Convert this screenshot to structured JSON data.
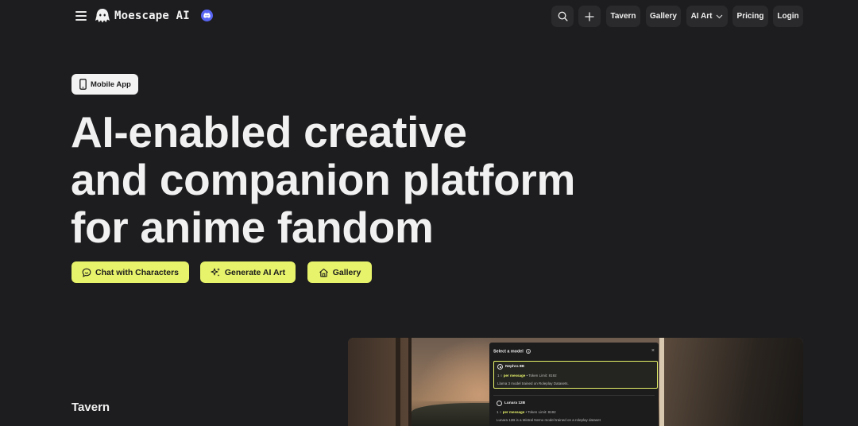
{
  "header": {
    "brand": "Moescape AI",
    "nav": {
      "tavern": "Tavern",
      "gallery": "Gallery",
      "ai_art": "AI Art",
      "pricing": "Pricing",
      "login": "Login"
    },
    "icons": [
      "menu-icon",
      "ghost-logo-icon",
      "discord-icon",
      "search-icon",
      "plus-icon",
      "chevron-down-icon"
    ]
  },
  "hero": {
    "mobile_app": "Mobile App",
    "headline": [
      "AI-enabled creative",
      "and companion platform",
      "for anime fandom"
    ],
    "cta": {
      "chat": "Chat with Characters",
      "generate": "Generate AI Art",
      "gallery": "Gallery"
    }
  },
  "section": {
    "tavern_label": "Tavern"
  },
  "preview_modal": {
    "title": "Select a model",
    "close": "×",
    "options": [
      {
        "name": "Nephra 8B",
        "cost_prefix": "1",
        "cost_unit": "per message",
        "limit": "• Token Limit: 8192",
        "description": "Llama 3 model trained on Roleplay Datasets."
      },
      {
        "name": "Lunara 12B",
        "cost_prefix": "1",
        "cost_unit": "per message",
        "limit": "• Token Limit: 8192",
        "description": "Lunara 12B is a Mistral Nemo model trained on a roleplay dataset"
      }
    ]
  },
  "colors": {
    "background": "#1d1d1f",
    "accent": "#e7f36a",
    "nav_button": "#2a2a2c",
    "discord": "#5865f2"
  }
}
